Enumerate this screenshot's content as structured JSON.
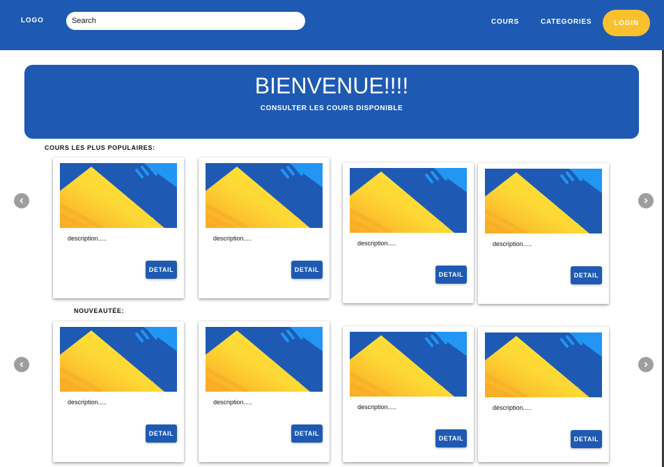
{
  "navbar": {
    "logo": "LOGO",
    "search_placeholder": "Search",
    "links": [
      "COURS",
      "CATEGORIES"
    ],
    "login_label": "LOGIN"
  },
  "hero": {
    "title": "BIENVENUE!!!!",
    "subtitle": "CONSULTER LES COURS DISPONIBLE"
  },
  "sections": [
    {
      "title": "COURS LES PLUS POPULAIRES:",
      "cards": [
        {
          "description": "description.....",
          "button": "DETAIL"
        },
        {
          "description": "description.....",
          "button": "DETAIL"
        },
        {
          "description": "description.....",
          "button": "DETAIL"
        },
        {
          "description": "description.....",
          "button": "DETAIL"
        }
      ]
    },
    {
      "title": "NOUVEAUTÉE:",
      "cards": [
        {
          "description": "description.....",
          "button": "DETAIL"
        },
        {
          "description": "description.....",
          "button": "DETAIL"
        },
        {
          "description": "description.....",
          "button": "DETAIL"
        },
        {
          "description": "description.....",
          "button": "DETAIL"
        }
      ]
    }
  ],
  "icons": {
    "prev": "chevron-left-icon",
    "next": "chevron-right-icon"
  },
  "colors": {
    "primary": "#1e5ab3",
    "accent": "#fbc02d",
    "arrow": "#9e9e9e"
  }
}
